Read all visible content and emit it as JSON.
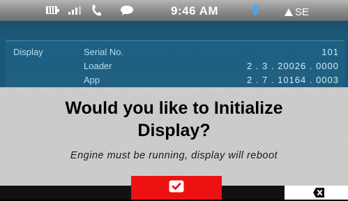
{
  "status_bar": {
    "time": "9:46 AM",
    "heading": "SE",
    "icons": [
      "battery-icon",
      "signal-icon",
      "phone-icon",
      "message-icon",
      "bluetooth-icon",
      "compass-arrow-icon"
    ]
  },
  "info": {
    "section_label": "Display",
    "rows": [
      {
        "label": "Serial No.",
        "value": "101"
      },
      {
        "label": "Loader",
        "value": "2 . 3 . 20026 . 0000"
      },
      {
        "label": "App",
        "value": "2 . 7 . 10164 . 0003"
      }
    ]
  },
  "dialog": {
    "question_line1": "Would you like to Initialize",
    "question_line2": "Display?",
    "message": "Engine must be running, display will reboot"
  },
  "buttons": {
    "confirm_icon": "checkmark-icon",
    "cancel_icon": "close-icon"
  },
  "colors": {
    "confirm": "#ee1111",
    "info_background": "#1b5777",
    "info_text": "#b9dcee"
  }
}
